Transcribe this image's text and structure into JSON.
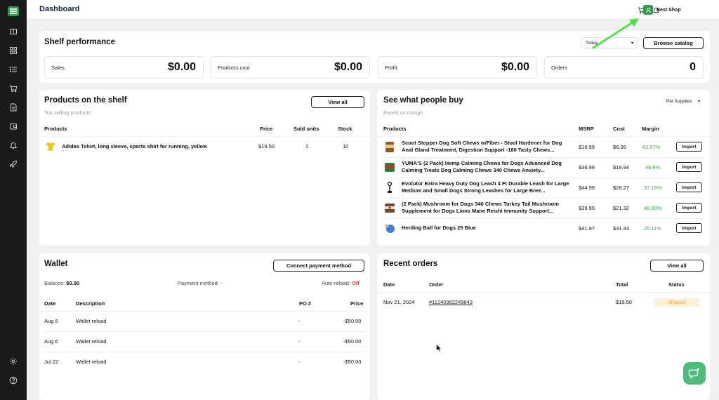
{
  "app": {
    "page_title": "Dashboard",
    "shop_name": "Best Shop"
  },
  "colors": {
    "brand": "#2e9c4f",
    "sidebar": "#1b1b1b",
    "margin_positive": "#3aa655",
    "status_shipped_bg": "#fdf0d9",
    "status_shipped_text": "#e8a54a",
    "off_text": "#e23b2e",
    "annotation_arrow": "#4fe24a"
  },
  "sidebar_icons": [
    "catalog-icon",
    "grid-icon",
    "list-icon",
    "cart-icon",
    "document-icon",
    "wallet-icon",
    "bell-icon",
    "rocket-icon",
    "gear-icon",
    "help-icon"
  ],
  "top_icons": [
    "cart-icon",
    "bell-icon",
    "user-icon"
  ],
  "shelf": {
    "title": "Shelf performance",
    "period": "Today",
    "browse_label": "Browse catalog",
    "metrics": [
      {
        "label": "Sales",
        "value": "$0.00"
      },
      {
        "label": "Products cost",
        "value": "$0.00"
      },
      {
        "label": "Profit",
        "value": "$0.00"
      },
      {
        "label": "Orders",
        "value": "0"
      }
    ]
  },
  "products_shelf": {
    "title": "Products on the shelf",
    "subtitle": "Top selling products",
    "view_all_label": "View all",
    "columns": [
      "Products",
      "Price",
      "Sold units",
      "Stock"
    ],
    "rows": [
      {
        "name": "Adidas Tshirt, long sleeve, sports shirt for running, yellow",
        "price": "$19.50",
        "sold": "1",
        "stock": "10"
      }
    ]
  },
  "people_buy": {
    "title": "See what people buy",
    "subtitle": "Based on margin",
    "category": "Pet Supplies",
    "columns": [
      "Products",
      "MSRP",
      "Cost",
      "Margin"
    ],
    "import_label": "Import",
    "rows": [
      {
        "name": "Scoot Stopper Dog Soft Chews w/Fiber - Stool Hardener for Dog Anal Gland Treatment, Digestion Support -180 Tasty Chews...",
        "msrp": "$16.99",
        "cost": "$6.36",
        "margin": "62.57%"
      },
      {
        "name": "YUMA'S (2 Pack) Hemp Calming Chews for Dogs Advanced Dog Calming Treats Dog Calming Chews 340 Chews Anxiety...",
        "msrp": "$36.99",
        "cost": "$18.94",
        "margin": "48.8%"
      },
      {
        "name": "Evolutor Extra Heavy Duty Dog Leash 4 Ft Durable Leash for Large Medium and Small Dogs Strong Leashes for Large Bree...",
        "msrp": "$44.99",
        "cost": "$28.27",
        "margin": "37.16%"
      },
      {
        "name": "(2 Pack) Mushroom for Dogs 340 Chews Turkey Tail Mushroom Supplement for Dogs Lions Mane Reishi Immunity Support...",
        "msrp": "$39.99",
        "cost": "$21.32",
        "margin": "46.69%"
      },
      {
        "name": "Herding Ball for Dogs 25 Blue",
        "msrp": "$41.97",
        "cost": "$31.43",
        "margin": "25.11%"
      }
    ]
  },
  "wallet": {
    "title": "Wallet",
    "connect_label": "Connect payment method",
    "balance_label": "Balance:",
    "balance_value": "$0.00",
    "payment_label": "Payment method:",
    "payment_value": "-",
    "autoreload_label": "Auto-reload:",
    "autoreload_value": "Off",
    "columns": [
      "Date",
      "Description",
      "PO #",
      "Price"
    ],
    "rows": [
      {
        "date": "Aug 6",
        "description": "Wallet reload",
        "po": "-",
        "price": "-$50.00"
      },
      {
        "date": "Aug 6",
        "description": "Wallet reload",
        "po": "-",
        "price": "-$50.00"
      },
      {
        "date": "Jul 22",
        "description": "Wallet reload",
        "po": "-",
        "price": "-$50.00"
      }
    ]
  },
  "recent_orders": {
    "title": "Recent orders",
    "view_all_label": "View all",
    "columns": [
      "Date",
      "Order",
      "Total",
      "Status"
    ],
    "rows": [
      {
        "date": "Nov 21, 2024",
        "order": "#11240982249843",
        "total": "$19.50",
        "status": "Shipped"
      }
    ]
  }
}
